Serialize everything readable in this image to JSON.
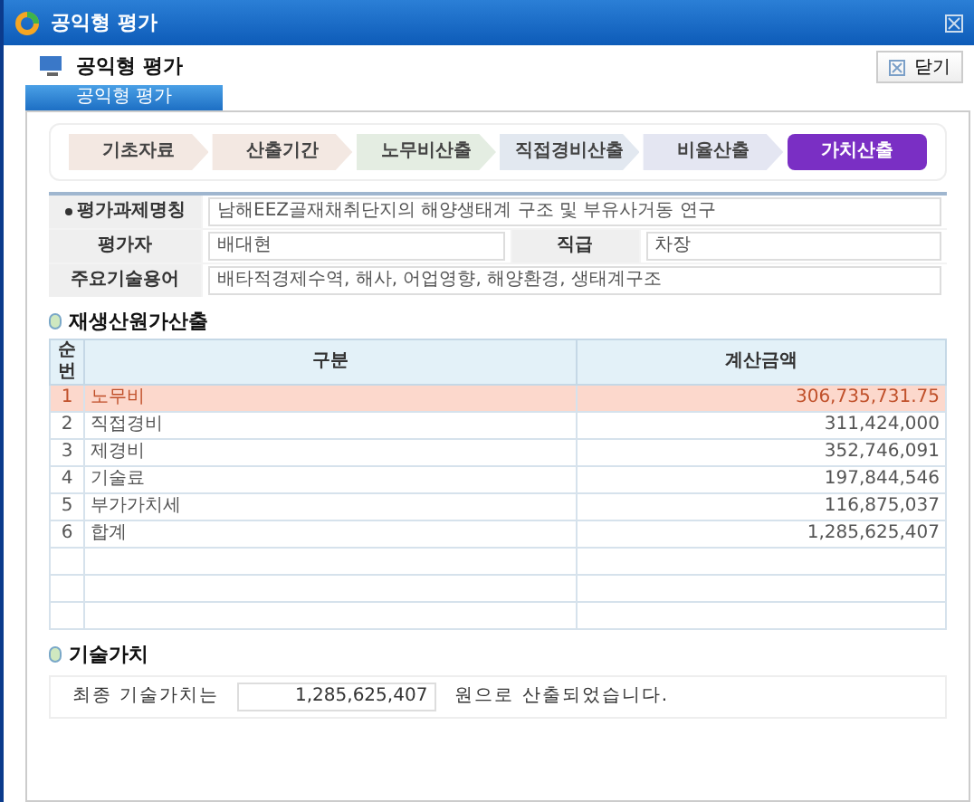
{
  "window": {
    "title": "공익형 평가"
  },
  "header": {
    "title": "공익형 평가",
    "close_button": "닫기"
  },
  "tabs": [
    {
      "label": "공익형 평가",
      "selected": true
    }
  ],
  "steps": [
    {
      "label": "기초자료",
      "selected": false,
      "color": "#f3e8e2"
    },
    {
      "label": "산출기간",
      "selected": false,
      "color": "#f3e8e2"
    },
    {
      "label": "노무비산출",
      "selected": false,
      "color": "#e4ede2"
    },
    {
      "label": "직접경비산출",
      "selected": false,
      "color": "#e2e8f0"
    },
    {
      "label": "비율산출",
      "selected": false,
      "color": "#e4e6f2"
    },
    {
      "label": "가치산출",
      "selected": true,
      "color": "#7a2fc4"
    }
  ],
  "form": {
    "project_label": "평가과제명칭",
    "project_value": "남해EEZ골재채취단지의 해양생태계 구조 및 부유사거동 연구",
    "evaluator_label": "평가자",
    "evaluator_value": "배대현",
    "rank_label": "직급",
    "rank_value": "차장",
    "keywords_label": "주요기술용어",
    "keywords_value": "배타적경제수역, 해사, 어업영향, 해양환경, 생태계구조"
  },
  "cost_section": {
    "title": "재생산원가산출",
    "table": {
      "columns": [
        "순번",
        "구분",
        "계산금액"
      ],
      "rows": [
        {
          "no": "1",
          "item": "노무비",
          "amount": "306,735,731.75",
          "selected": true
        },
        {
          "no": "2",
          "item": "직접경비",
          "amount": "311,424,000",
          "selected": false
        },
        {
          "no": "3",
          "item": "제경비",
          "amount": "352,746,091",
          "selected": false
        },
        {
          "no": "4",
          "item": "기술료",
          "amount": "197,844,546",
          "selected": false
        },
        {
          "no": "5",
          "item": "부가가치세",
          "amount": "116,875,037",
          "selected": false
        },
        {
          "no": "6",
          "item": "합계",
          "amount": "1,285,625,407",
          "selected": false
        }
      ]
    }
  },
  "value_section": {
    "title": "기술가치",
    "prefix": "최종 기술가치는",
    "value": "1,285,625,407",
    "suffix": "원으로 산출되었습니다."
  }
}
